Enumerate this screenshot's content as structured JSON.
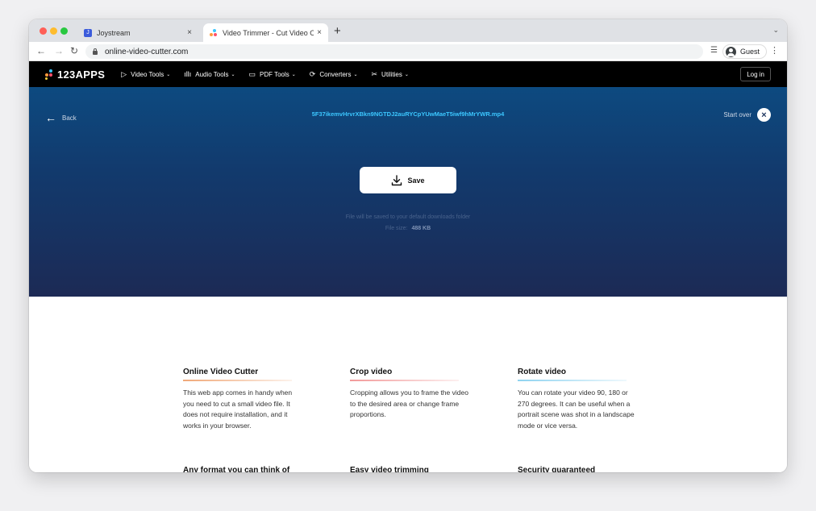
{
  "browser": {
    "tabs": [
      {
        "title": "Joystream",
        "close": "×"
      },
      {
        "title": "Video Trimmer - Cut Video Onl",
        "close": "×"
      }
    ],
    "new_tab": "+",
    "tab_menu": "⌄",
    "nav": {
      "back": "←",
      "forward": "→",
      "reload": "↻"
    },
    "url": "online-video-cutter.com",
    "profile_label": "Guest",
    "reading_list": "☰",
    "menu": "⋮"
  },
  "app": {
    "logo": "123APPS",
    "menu": [
      {
        "label": "Video Tools",
        "icon": "▷"
      },
      {
        "label": "Audio Tools",
        "icon": "ıllı"
      },
      {
        "label": "PDF Tools",
        "icon": "▭"
      },
      {
        "label": "Converters",
        "icon": "⟳"
      },
      {
        "label": "Utilities",
        "icon": "✂"
      }
    ],
    "chevron": "⌄",
    "login": "Log in"
  },
  "hero": {
    "back_label": "Back",
    "back_arrow": "←",
    "filename": "5F37ikemvHrvrXBkn9NGTDJ2auRYCpYUwMaeT5iwf9hMrYWR.mp4",
    "start_over": "Start over",
    "close_glyph": "×",
    "save_label": "Save",
    "note": "File will be saved to your default downloads folder",
    "file_size_label": "File size:",
    "file_size_value": "488 KB"
  },
  "features": [
    {
      "title": "Online Video Cutter",
      "text": "This web app comes in handy when you need to cut a small video file. It does not require installation, and it works in your browser."
    },
    {
      "title": "Crop video",
      "text": "Cropping allows you to frame the video to the desired area or change frame proportions."
    },
    {
      "title": "Rotate video",
      "text": "You can rotate your video 90, 180 or 270 degrees. It can be useful when a portrait scene was shot in a landscape mode or vice versa."
    }
  ],
  "features_row2": [
    {
      "title": "Any format you can think of"
    },
    {
      "title": "Easy video trimming"
    },
    {
      "title": "Security guaranteed"
    }
  ],
  "colors": {
    "accent_filename": "#3cc7ff",
    "underline_1": "#f0a878",
    "underline_2": "#f29a9a",
    "underline_3": "#8fd3f0"
  }
}
